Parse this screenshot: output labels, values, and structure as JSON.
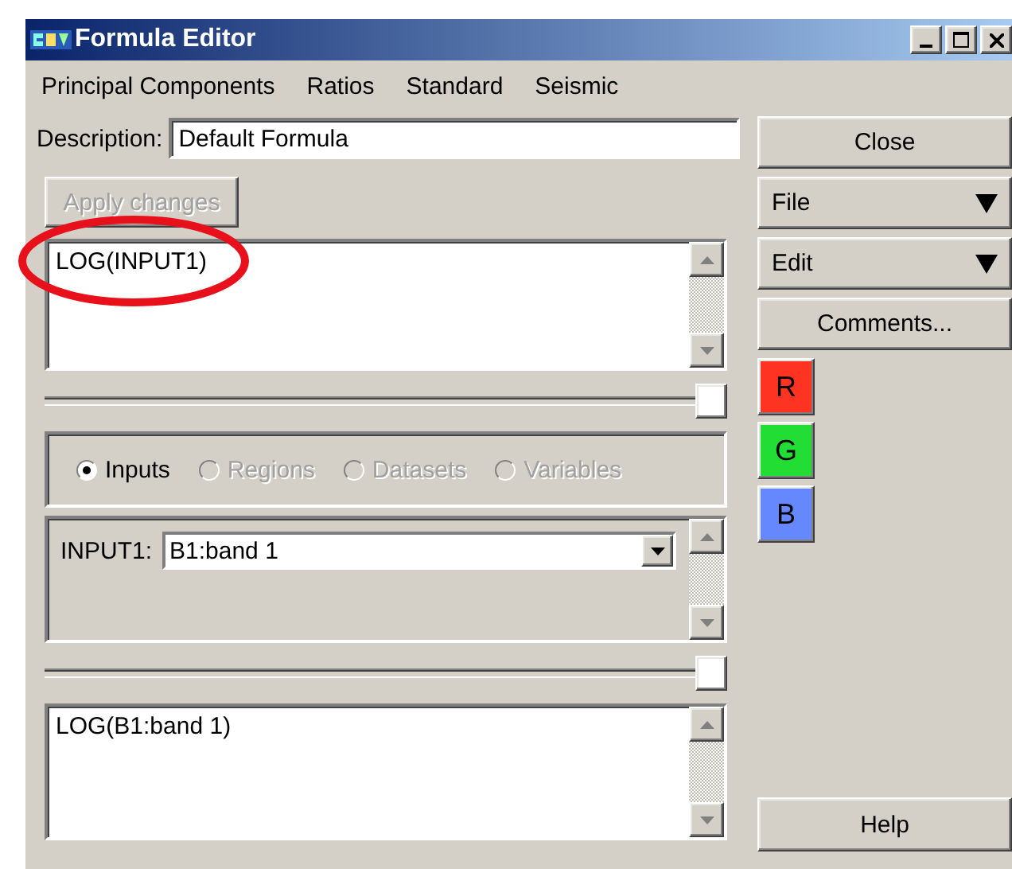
{
  "window": {
    "title": "Formula Editor"
  },
  "menu": [
    "Principal Components",
    "Ratios",
    "Standard",
    "Seismic"
  ],
  "description": {
    "label": "Description:",
    "value": "Default Formula"
  },
  "apply_button": {
    "label": "Apply changes",
    "disabled": true
  },
  "formula": {
    "text": "LOG(INPUT1)"
  },
  "upper_splitter": {
    "level": 1
  },
  "source_options": [
    {
      "label": "Inputs",
      "selected": true,
      "disabled": false
    },
    {
      "label": "Regions",
      "selected": false,
      "disabled": true
    },
    {
      "label": "Datasets",
      "selected": false,
      "disabled": true
    },
    {
      "label": "Variables",
      "selected": false,
      "disabled": true
    }
  ],
  "inputs": [
    {
      "label": "INPUT1:",
      "value": "B1:band 1"
    }
  ],
  "lower_splitter": {
    "level": 1
  },
  "result": {
    "text": "LOG(B1:band 1)"
  },
  "side_buttons": [
    {
      "label": "Close",
      "kind": "plain"
    },
    {
      "label": "File",
      "kind": "dropdown"
    },
    {
      "label": "Edit",
      "kind": "dropdown"
    },
    {
      "label": "Comments...",
      "kind": "plain"
    }
  ],
  "channels": [
    {
      "label": "R",
      "color": "#ff3322"
    },
    {
      "label": "G",
      "color": "#22dd33"
    },
    {
      "label": "B",
      "color": "#6688ff"
    }
  ],
  "help_button": {
    "label": "Help"
  }
}
